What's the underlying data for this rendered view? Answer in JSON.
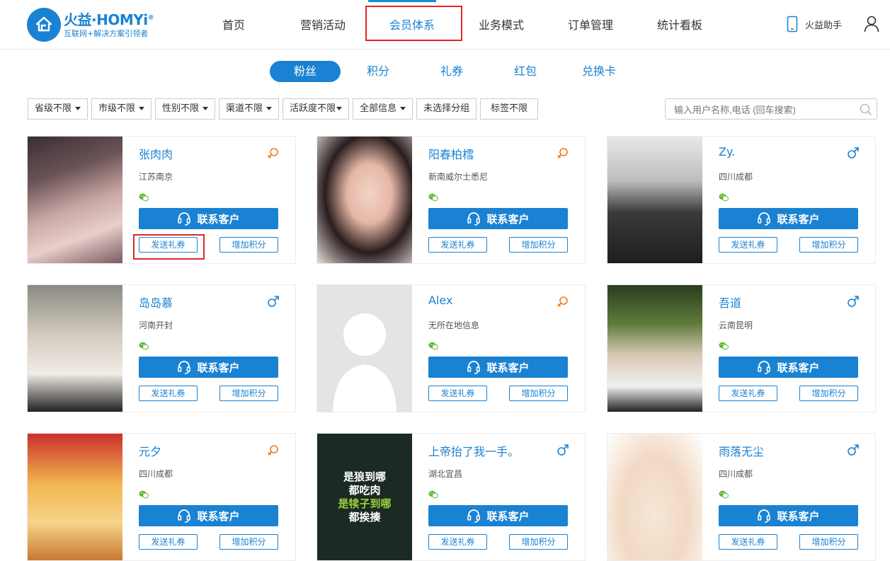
{
  "logo": {
    "brand": "火益·HOMYi",
    "reg": "®",
    "slogan": "互联网+解决方案引领者"
  },
  "nav": {
    "items": [
      "首页",
      "营销活动",
      "会员体系",
      "业务模式",
      "订单管理",
      "统计看板"
    ],
    "active": "会员体系"
  },
  "header": {
    "helper_label": "火益助手"
  },
  "tabs": [
    "粉丝",
    "积分",
    "礼券",
    "红包",
    "兑换卡"
  ],
  "filters": [
    {
      "label": "省级不限",
      "dropdown": true
    },
    {
      "label": "市级不限",
      "dropdown": true
    },
    {
      "label": "性别不限",
      "dropdown": true
    },
    {
      "label": "渠道不限",
      "dropdown": true
    },
    {
      "label": "活跃度不限",
      "dropdown": true
    },
    {
      "label": "全部信息",
      "dropdown": true
    },
    {
      "label": "未选择分组",
      "dropdown": false
    },
    {
      "label": "标签不限",
      "dropdown": false
    }
  ],
  "search": {
    "placeholder": "输入用户名称,电话 (回车搜索)"
  },
  "card_buttons": {
    "contact": "联系客户",
    "send_coupon": "发送礼券",
    "add_points": "增加积分"
  },
  "members": [
    {
      "name": "张肉肉",
      "location": "江苏南京",
      "gender": "female"
    },
    {
      "name": "阳春柏樰",
      "location": "新南威尔士悉尼",
      "gender": "female"
    },
    {
      "name": "Zy.",
      "location": "四川成都",
      "gender": "male"
    },
    {
      "name": "岛岛慕",
      "location": "河南开封",
      "gender": "male"
    },
    {
      "name": "Alex",
      "location": "无所在地信息",
      "gender": "female"
    },
    {
      "name": "吾道",
      "location": "云南昆明",
      "gender": "male"
    },
    {
      "name": "元夕",
      "location": "四川成都",
      "gender": "female"
    },
    {
      "name": "上帝抬了我一手。",
      "location": "湖北宜昌",
      "gender": "male"
    },
    {
      "name": "雨落无尘",
      "location": "四川成都",
      "gender": "male"
    }
  ],
  "poster_text": [
    "是狼到哪",
    "都吃肉",
    "是犊子到哪",
    "都挨揍"
  ],
  "colors": {
    "accent": "#1a82d2",
    "highlight": "#e02727",
    "female": "#f07a1a",
    "male": "#1a82d2"
  }
}
